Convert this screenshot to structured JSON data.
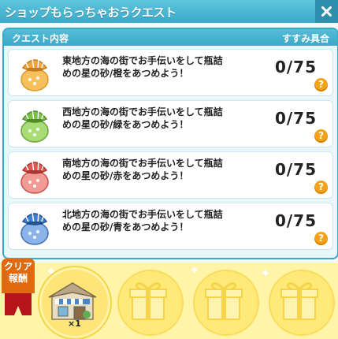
{
  "window": {
    "title": "ショップもらっちゃおうクエスト"
  },
  "header": {
    "left": "クエスト内容",
    "right": "すすみ具合"
  },
  "quests": [
    {
      "text": "東地方の海の街でお手伝いをして瓶詰めの星の砂/橙をあつめよう！",
      "progress": "0/75",
      "color": "#f0a23c",
      "bag_color": "#f6c05c"
    },
    {
      "text": "西地方の海の街でお手伝いをして瓶詰めの星の砂/緑をあつめよう！",
      "progress": "0/75",
      "color": "#7bbf45",
      "bag_color": "#a9dc74"
    },
    {
      "text": "南地方の海の街でお手伝いをして瓶詰めの星の砂/赤をあつめよう！",
      "progress": "0/75",
      "color": "#e0574f",
      "bag_color": "#f29a94"
    },
    {
      "text": "北地方の海の街でお手伝いをして瓶詰めの星の砂/青をあつめよう！",
      "progress": "0/75",
      "color": "#3f7fcf",
      "bag_color": "#8ab4ea"
    }
  ],
  "reward": {
    "label_line1": "クリア",
    "label_line2": "報酬",
    "quantity": "×1"
  }
}
